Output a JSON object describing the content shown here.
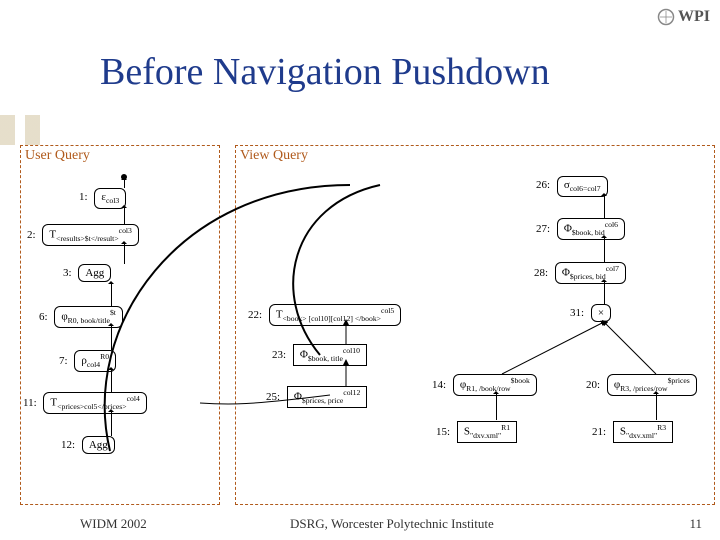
{
  "logo_text": "WPI",
  "title": "Before Navigation Pushdown",
  "panels": {
    "user": {
      "label": "User Query"
    },
    "view": {
      "label": "View Query"
    }
  },
  "user_nodes": {
    "n1": {
      "num": "1:",
      "expr_e": "ε",
      "sub": "col3"
    },
    "n2": {
      "num": "2:",
      "t": "T",
      "body": "<results>$t</result>",
      "sup": "col3"
    },
    "n3": {
      "num": "3:",
      "expr": "Agg"
    },
    "n6": {
      "num": "6:",
      "phi": "φ",
      "sub": "R0, book/title",
      "sup": "$t"
    },
    "n7": {
      "num": "7:",
      "rho": "ρ",
      "sub": "col4",
      "sup": "R0"
    },
    "n11": {
      "num": "11:",
      "t": "T",
      "body": "<prices>col5</prices>",
      "sup": "col4"
    },
    "n12": {
      "num": "12:",
      "expr": "Agg"
    }
  },
  "view_nodes": {
    "n26": {
      "num": "26:",
      "sigma": "σ",
      "sub": "col6=col7"
    },
    "n27": {
      "num": "27:",
      "phi": "Φ",
      "sub": "$book, bid",
      "sup": "col6"
    },
    "n28": {
      "num": "28:",
      "phi": "Φ",
      "sub": "$prices, bid",
      "sup": "col7"
    },
    "n22": {
      "num": "22:",
      "t": "T",
      "body": "<book> [col10][col12] </book>",
      "sup": "col5"
    },
    "n31": {
      "num": "31:",
      "expr": "×"
    },
    "n23": {
      "num": "23:",
      "phi": "Φ",
      "sub": "$book, title",
      "sup": "col10"
    },
    "n25": {
      "num": "25:",
      "phi": "Φ",
      "sub": "$prices, price",
      "sup": "col12"
    },
    "n14": {
      "num": "14:",
      "phi": "φ",
      "sub": "R1, /book/row",
      "sup": "$book"
    },
    "n20": {
      "num": "20:",
      "phi": "φ",
      "sub": "R3, /prices/row",
      "sup": "$prices"
    },
    "n15": {
      "num": "15:",
      "s": "S",
      "sub": "\"dxv.xml\"",
      "sup": "R1"
    },
    "n21": {
      "num": "21:",
      "s": "S",
      "sub": "\"dxv.xml\"",
      "sup": "R3"
    }
  },
  "footer": {
    "left": "WIDM 2002",
    "mid": "DSRG, Worcester Polytechnic Institute",
    "page": "11"
  }
}
